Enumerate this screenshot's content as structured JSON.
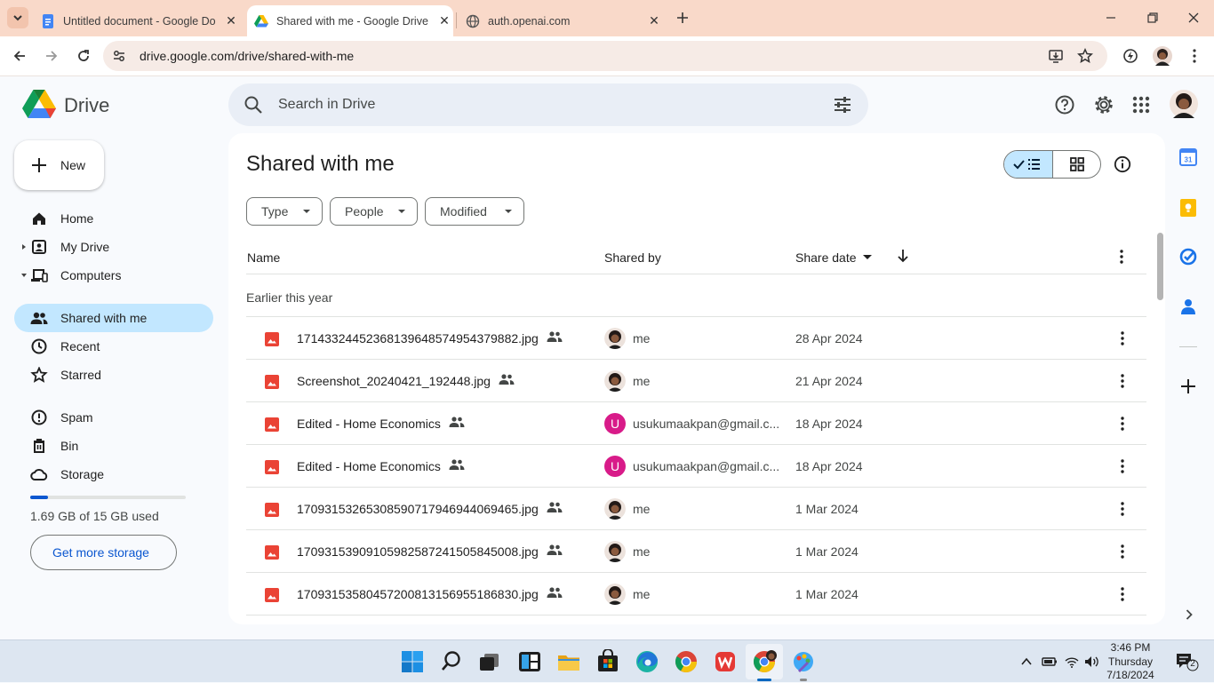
{
  "browser": {
    "tabs": [
      {
        "title": "Untitled document - Google Do",
        "favicon": "google-docs-icon",
        "active": false
      },
      {
        "title": "Shared with me - Google Drive",
        "favicon": "google-drive-icon",
        "active": true
      },
      {
        "title": "auth.openai.com",
        "favicon": "globe-icon",
        "active": false
      }
    ],
    "url": "drive.google.com/drive/shared-with-me"
  },
  "drive": {
    "logo_text": "Drive",
    "search_placeholder": "Search in Drive",
    "new_button": "New",
    "nav": [
      {
        "label": "Home",
        "icon": "home-icon"
      },
      {
        "label": "My Drive",
        "icon": "my-drive-icon"
      },
      {
        "label": "Computers",
        "icon": "computer-icon"
      },
      {
        "label": "Shared with me",
        "icon": "people-icon",
        "active": true
      },
      {
        "label": "Recent",
        "icon": "clock-icon"
      },
      {
        "label": "Starred",
        "icon": "star-icon"
      },
      {
        "label": "Spam",
        "icon": "spam-icon"
      },
      {
        "label": "Bin",
        "icon": "bin-icon"
      },
      {
        "label": "Storage",
        "icon": "cloud-icon"
      }
    ],
    "storage": {
      "used_text": "1.69 GB of 15 GB used",
      "fraction": 0.113,
      "button": "Get more storage"
    },
    "page_title": "Shared with me",
    "filters": [
      "Type",
      "People",
      "Modified"
    ],
    "columns": {
      "name": "Name",
      "shared_by": "Shared by",
      "share_date": "Share date"
    },
    "group_label": "Earlier this year",
    "files": [
      {
        "name": "17143324452368139648574954379882.jpg",
        "by": "me",
        "avatar": "photo",
        "date": "28 Apr 2024"
      },
      {
        "name": "Screenshot_20240421_192448.jpg",
        "by": "me",
        "avatar": "photo",
        "date": "21 Apr 2024"
      },
      {
        "name": "Edited - Home Economics",
        "by": "usukumaakpan@gmail.c...",
        "avatar": "U",
        "date": "18 Apr 2024"
      },
      {
        "name": "Edited - Home Economics",
        "by": "usukumaakpan@gmail.c...",
        "avatar": "U",
        "date": "18 Apr 2024"
      },
      {
        "name": "17093153265308590717946944069465.jpg",
        "by": "me",
        "avatar": "photo",
        "date": "1 Mar 2024"
      },
      {
        "name": "17093153909105982587241505845008.jpg",
        "by": "me",
        "avatar": "photo",
        "date": "1 Mar 2024"
      },
      {
        "name": "17093153580457200813156955186830.jpg",
        "by": "me",
        "avatar": "photo",
        "date": "1 Mar 2024"
      }
    ]
  },
  "taskbar": {
    "time": "3:46 PM",
    "day": "Thursday",
    "date": "7/18/2024",
    "notifications": "2"
  },
  "colors": {
    "tab_strip": "#f9d9c9",
    "drive_active": "#c2e7ff",
    "image_file": "#ea4335",
    "storage_bar": "#0b57d0"
  }
}
